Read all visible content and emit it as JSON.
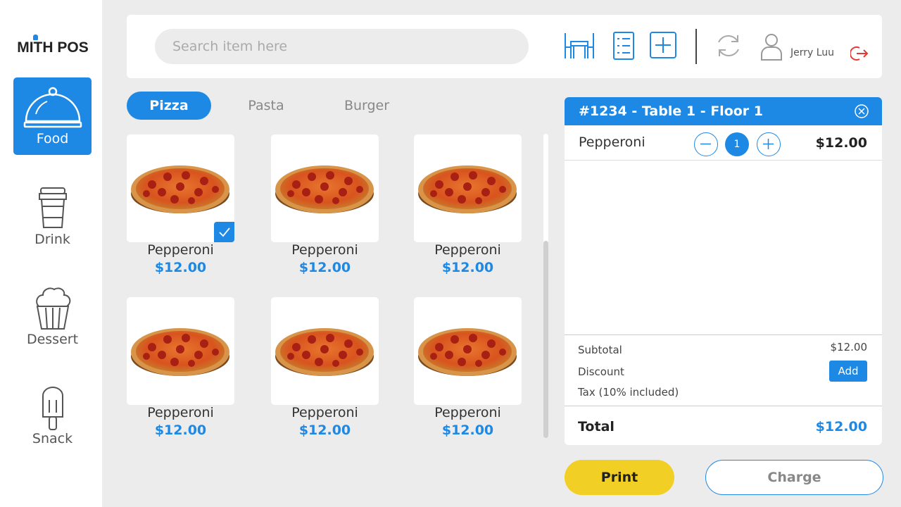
{
  "app": {
    "logo": "MITH POS"
  },
  "sidebar": {
    "items": [
      {
        "label": "Food",
        "icon": "cloche-icon",
        "active": true
      },
      {
        "label": "Drink",
        "icon": "coffee-cup-icon",
        "active": false
      },
      {
        "label": "Dessert",
        "icon": "cupcake-icon",
        "active": false
      },
      {
        "label": "Snack",
        "icon": "popsicle-icon",
        "active": false
      }
    ]
  },
  "topbar": {
    "search_placeholder": "Search item here",
    "icons": [
      "table-icon",
      "list-icon",
      "add-icon",
      "refresh-icon",
      "user-icon",
      "logout-icon"
    ],
    "user_name": "Jerry Luu"
  },
  "tabs": [
    {
      "label": "Pizza",
      "active": true
    },
    {
      "label": "Pasta",
      "active": false
    },
    {
      "label": "Burger",
      "active": false
    }
  ],
  "products": [
    {
      "name": "Pepperoni",
      "price": "$12.00",
      "selected": true
    },
    {
      "name": "Pepperoni",
      "price": "$12.00",
      "selected": false
    },
    {
      "name": "Pepperoni",
      "price": "$12.00",
      "selected": false
    },
    {
      "name": "Pepperoni",
      "price": "$12.00",
      "selected": false
    },
    {
      "name": "Pepperoni",
      "price": "$12.00",
      "selected": false
    },
    {
      "name": "Pepperoni",
      "price": "$12.00",
      "selected": false
    }
  ],
  "order": {
    "title": "#1234 - Table 1 - Floor 1",
    "items": [
      {
        "name": "Pepperoni",
        "qty": "1",
        "price": "$12.00"
      }
    ],
    "subtotal_label": "Subtotal",
    "subtotal_value": "$12.00",
    "discount_label": "Discount",
    "discount_button": "Add",
    "tax_label": "Tax (10% included)",
    "total_label": "Total",
    "total_value": "$12.00"
  },
  "actions": {
    "print": "Print",
    "charge": "Charge"
  },
  "colors": {
    "accent": "#1e88e5",
    "print": "#f2cf24",
    "logout": "#e53935"
  }
}
